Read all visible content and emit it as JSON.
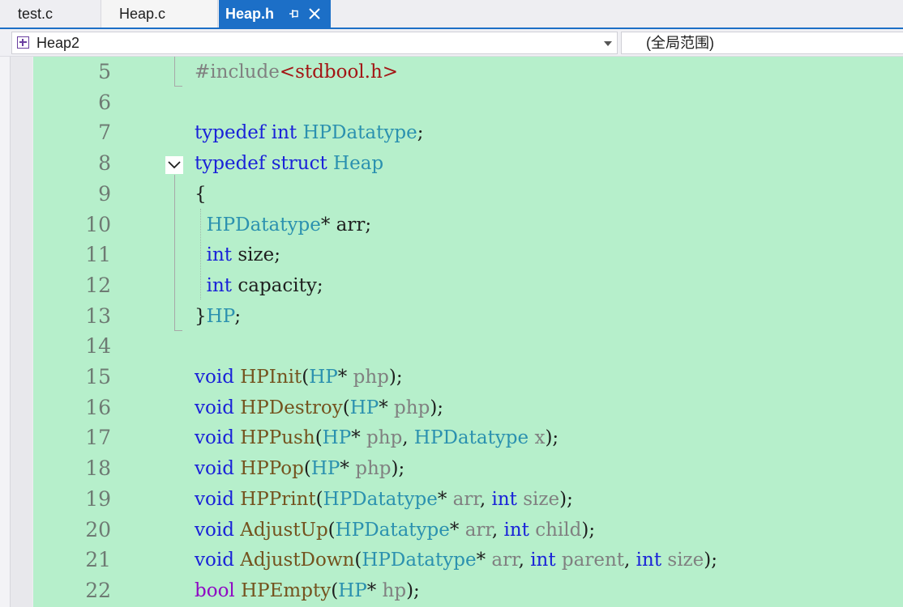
{
  "tabs": [
    {
      "label": "test.c",
      "active": false
    },
    {
      "label": "Heap.c",
      "active": false
    },
    {
      "label": "Heap.h",
      "active": true
    }
  ],
  "tab_icons": {
    "pin": "pin-icon",
    "close": "close-icon"
  },
  "navbar": {
    "project_combo": "Heap2",
    "scope_combo": "(全局范围)"
  },
  "colors": {
    "editor_background": "#b6efcb",
    "active_tab": "#1c6fc7",
    "keyword": "#1a22d8",
    "type": "#2b91af",
    "function": "#74531f",
    "parameter": "#808080",
    "string": "#a31515"
  },
  "editor": {
    "lines": [
      {
        "num": "5",
        "tokens": [
          [
            "pp",
            "#include"
          ],
          [
            "st",
            "<stdbool.h>"
          ]
        ]
      },
      {
        "num": "6",
        "tokens": []
      },
      {
        "num": "7",
        "tokens": [
          [
            "kw",
            "typedef"
          ],
          [
            "pu",
            " "
          ],
          [
            "kw",
            "int"
          ],
          [
            "pu",
            " "
          ],
          [
            "ty",
            "HPDatatype"
          ],
          [
            "pu",
            ";"
          ]
        ]
      },
      {
        "num": "8",
        "tokens": [
          [
            "kw",
            "typedef"
          ],
          [
            "pu",
            " "
          ],
          [
            "kw",
            "struct"
          ],
          [
            "pu",
            " "
          ],
          [
            "ty",
            "Heap"
          ]
        ]
      },
      {
        "num": "9",
        "tokens": [
          [
            "pu",
            "{"
          ]
        ]
      },
      {
        "num": "10",
        "tokens": [
          [
            "pu",
            "  "
          ],
          [
            "ty",
            "HPDatatype"
          ],
          [
            "pu",
            "* arr;"
          ]
        ]
      },
      {
        "num": "11",
        "tokens": [
          [
            "pu",
            "  "
          ],
          [
            "kw",
            "int"
          ],
          [
            "pu",
            " size;"
          ]
        ]
      },
      {
        "num": "12",
        "tokens": [
          [
            "pu",
            "  "
          ],
          [
            "kw",
            "int"
          ],
          [
            "pu",
            " capacity;"
          ]
        ]
      },
      {
        "num": "13",
        "tokens": [
          [
            "pu",
            "}"
          ],
          [
            "ty",
            "HP"
          ],
          [
            "pu",
            ";"
          ]
        ]
      },
      {
        "num": "14",
        "tokens": []
      },
      {
        "num": "15",
        "tokens": [
          [
            "kw",
            "void"
          ],
          [
            "pu",
            " "
          ],
          [
            "fn",
            "HPInit"
          ],
          [
            "pu",
            "("
          ],
          [
            "ty",
            "HP"
          ],
          [
            "pu",
            "* "
          ],
          [
            "pm",
            "php"
          ],
          [
            "pu",
            ");"
          ]
        ]
      },
      {
        "num": "16",
        "tokens": [
          [
            "kw",
            "void"
          ],
          [
            "pu",
            " "
          ],
          [
            "fn",
            "HPDestroy"
          ],
          [
            "pu",
            "("
          ],
          [
            "ty",
            "HP"
          ],
          [
            "pu",
            "* "
          ],
          [
            "pm",
            "php"
          ],
          [
            "pu",
            ");"
          ]
        ]
      },
      {
        "num": "17",
        "tokens": [
          [
            "kw",
            "void"
          ],
          [
            "pu",
            " "
          ],
          [
            "fn",
            "HPPush"
          ],
          [
            "pu",
            "("
          ],
          [
            "ty",
            "HP"
          ],
          [
            "pu",
            "* "
          ],
          [
            "pm",
            "php"
          ],
          [
            "pu",
            ", "
          ],
          [
            "ty",
            "HPDatatype"
          ],
          [
            "pu",
            " "
          ],
          [
            "pm",
            "x"
          ],
          [
            "pu",
            ");"
          ]
        ]
      },
      {
        "num": "18",
        "tokens": [
          [
            "kw",
            "void"
          ],
          [
            "pu",
            " "
          ],
          [
            "fn",
            "HPPop"
          ],
          [
            "pu",
            "("
          ],
          [
            "ty",
            "HP"
          ],
          [
            "pu",
            "* "
          ],
          [
            "pm",
            "php"
          ],
          [
            "pu",
            ");"
          ]
        ]
      },
      {
        "num": "19",
        "tokens": [
          [
            "kw",
            "void"
          ],
          [
            "pu",
            " "
          ],
          [
            "fn",
            "HPPrint"
          ],
          [
            "pu",
            "("
          ],
          [
            "ty",
            "HPDatatype"
          ],
          [
            "pu",
            "* "
          ],
          [
            "pm",
            "arr"
          ],
          [
            "pu",
            ", "
          ],
          [
            "kw",
            "int"
          ],
          [
            "pu",
            " "
          ],
          [
            "pm",
            "size"
          ],
          [
            "pu",
            ");"
          ]
        ]
      },
      {
        "num": "20",
        "tokens": [
          [
            "kw",
            "void"
          ],
          [
            "pu",
            " "
          ],
          [
            "fn",
            "AdjustUp"
          ],
          [
            "pu",
            "("
          ],
          [
            "ty",
            "HPDatatype"
          ],
          [
            "pu",
            "* "
          ],
          [
            "pm",
            "arr"
          ],
          [
            "pu",
            ", "
          ],
          [
            "kw",
            "int"
          ],
          [
            "pu",
            " "
          ],
          [
            "pm",
            "child"
          ],
          [
            "pu",
            ");"
          ]
        ]
      },
      {
        "num": "21",
        "tokens": [
          [
            "kw",
            "void"
          ],
          [
            "pu",
            " "
          ],
          [
            "fn",
            "AdjustDown"
          ],
          [
            "pu",
            "("
          ],
          [
            "ty",
            "HPDatatype"
          ],
          [
            "pu",
            "* "
          ],
          [
            "pm",
            "arr"
          ],
          [
            "pu",
            ", "
          ],
          [
            "kw",
            "int"
          ],
          [
            "pu",
            " "
          ],
          [
            "pm",
            "parent"
          ],
          [
            "pu",
            ", "
          ],
          [
            "kw",
            "int"
          ],
          [
            "pu",
            " "
          ],
          [
            "pm",
            "size"
          ],
          [
            "pu",
            ");"
          ]
        ]
      },
      {
        "num": "22",
        "tokens": [
          [
            "kb",
            "bool"
          ],
          [
            "pu",
            " "
          ],
          [
            "fn",
            "HPEmpty"
          ],
          [
            "pu",
            "("
          ],
          [
            "ty",
            "HP"
          ],
          [
            "pu",
            "* "
          ],
          [
            "pm",
            "hp"
          ],
          [
            "pu",
            ");"
          ]
        ]
      }
    ]
  }
}
